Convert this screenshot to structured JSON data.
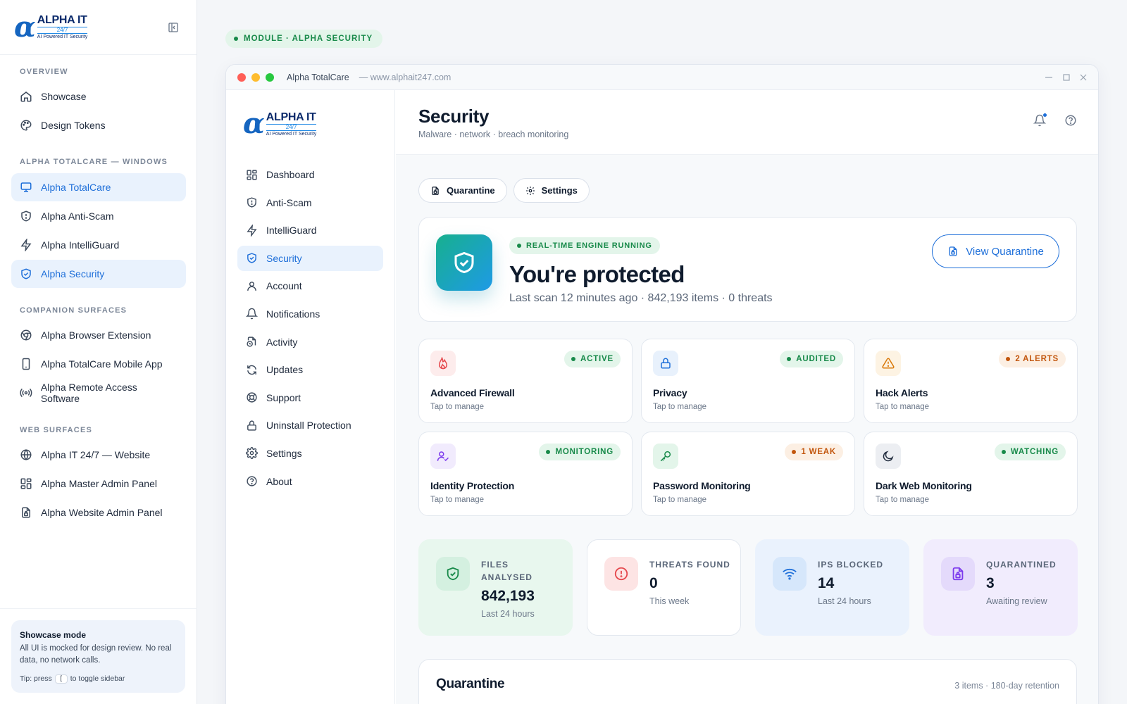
{
  "brand": {
    "name": "ALPHA IT",
    "tagline_247": "24/7",
    "tagline": "AI Powered IT Security"
  },
  "sidebar": {
    "sections": [
      {
        "title": "OVERVIEW",
        "items": [
          {
            "label": "Showcase",
            "icon": "home-icon"
          },
          {
            "label": "Design Tokens",
            "icon": "palette-icon"
          }
        ]
      },
      {
        "title": "ALPHA TOTALCARE — WINDOWS",
        "items": [
          {
            "label": "Alpha TotalCare",
            "icon": "monitor-icon",
            "active": true
          },
          {
            "label": "Alpha Anti-Scam",
            "icon": "shield-alert-icon"
          },
          {
            "label": "Alpha IntelliGuard",
            "icon": "lightning-icon"
          },
          {
            "label": "Alpha Security",
            "icon": "shield-check-icon",
            "active": true
          }
        ]
      },
      {
        "title": "COMPANION SURFACES",
        "items": [
          {
            "label": "Alpha Browser Extension",
            "icon": "chrome-icon"
          },
          {
            "label": "Alpha TotalCare Mobile App",
            "icon": "phone-icon"
          },
          {
            "label": "Alpha Remote Access Software",
            "icon": "broadcast-icon"
          }
        ]
      },
      {
        "title": "WEB SURFACES",
        "items": [
          {
            "label": "Alpha IT 24/7 — Website",
            "icon": "globe-icon"
          },
          {
            "label": "Alpha Master Admin Panel",
            "icon": "grid-icon"
          },
          {
            "label": "Alpha Website Admin Panel",
            "icon": "file-lock-icon"
          }
        ]
      }
    ],
    "showcase": {
      "title": "Showcase mode",
      "desc": "All UI is mocked for design review. No real data, no network calls.",
      "tip_pre": "Tip: press",
      "tip_key": "[",
      "tip_post": "to toggle sidebar"
    }
  },
  "module_pill": "MODULE · ALPHA SECURITY",
  "window": {
    "title": "Alpha TotalCare",
    "url": "— www.alphait247.com",
    "nav": [
      {
        "label": "Dashboard",
        "icon": "grid-icon"
      },
      {
        "label": "Anti-Scam",
        "icon": "shield-alert-icon"
      },
      {
        "label": "IntelliGuard",
        "icon": "lightning-icon"
      },
      {
        "label": "Security",
        "icon": "shield-check-icon",
        "active": true
      },
      {
        "label": "Account",
        "icon": "user-icon"
      },
      {
        "label": "Notifications",
        "icon": "bell-icon"
      },
      {
        "label": "Activity",
        "icon": "file-clock-icon"
      },
      {
        "label": "Updates",
        "icon": "refresh-icon"
      },
      {
        "label": "Support",
        "icon": "lifebuoy-icon"
      },
      {
        "label": "Uninstall Protection",
        "icon": "lock-icon"
      },
      {
        "label": "Settings",
        "icon": "gear-icon"
      },
      {
        "label": "About",
        "icon": "help-icon"
      }
    ],
    "page": {
      "title": "Security",
      "subtitle": "Malware · network · breach monitoring"
    },
    "actions": {
      "quarantine": "Quarantine",
      "settings": "Settings"
    },
    "hero": {
      "pill": "REAL-TIME ENGINE RUNNING",
      "title": "You're protected",
      "subtitle": "Last scan 12 minutes ago · 842,193 items · 0 threats",
      "button": "View Quarantine"
    },
    "features": [
      {
        "name": "Advanced Firewall",
        "sub": "Tap to manage",
        "badge": "ACTIVE",
        "tone": "green",
        "icon": "flame-icon",
        "icon_color": "#e5484d",
        "icon_bg": "#fdecec"
      },
      {
        "name": "Privacy",
        "sub": "Tap to manage",
        "badge": "AUDITED",
        "tone": "green",
        "icon": "lock-icon",
        "icon_color": "#1e6fd9",
        "icon_bg": "#e8f1fc"
      },
      {
        "name": "Hack Alerts",
        "sub": "Tap to manage",
        "badge": "2 ALERTS",
        "tone": "orange",
        "icon": "warning-icon",
        "icon_color": "#d97706",
        "icon_bg": "#fdf3e3"
      },
      {
        "name": "Identity Protection",
        "sub": "Tap to manage",
        "badge": "MONITORING",
        "tone": "green",
        "icon": "user-check-icon",
        "icon_color": "#7c3aed",
        "icon_bg": "#f1ebfd"
      },
      {
        "name": "Password Monitoring",
        "sub": "Tap to manage",
        "badge": "1 WEAK",
        "tone": "orange",
        "icon": "key-icon",
        "icon_color": "#188a4a",
        "icon_bg": "#e3f5ea"
      },
      {
        "name": "Dark Web Monitoring",
        "sub": "Tap to manage",
        "badge": "WATCHING",
        "tone": "green",
        "icon": "moon-icon",
        "icon_color": "#1f2a3c",
        "icon_bg": "#eceef2"
      }
    ],
    "stats": [
      {
        "label": "FILES ANALYSED",
        "value": "842,193",
        "sub": "Last 24 hours",
        "icon": "shield-check-icon",
        "bg": "#e8f7ee",
        "icon_bg": "#d4f0e0",
        "icon_color": "#188a4a"
      },
      {
        "label": "THREATS FOUND",
        "value": "0",
        "sub": "This week",
        "icon": "alert-circle-icon",
        "bg": "#ffffff",
        "icon_bg": "#fde4e4",
        "icon_color": "#e5484d"
      },
      {
        "label": "IPS BLOCKED",
        "value": "14",
        "sub": "Last 24 hours",
        "icon": "wifi-icon",
        "bg": "#eaf2fd",
        "icon_bg": "#d6e7fb",
        "icon_color": "#1e6fd9"
      },
      {
        "label": "QUARANTINED",
        "value": "3",
        "sub": "Awaiting review",
        "icon": "file-lock-icon",
        "bg": "#f1ecfd",
        "icon_bg": "#e4dafb",
        "icon_color": "#7c3aed"
      }
    ],
    "quarantine": {
      "title": "Quarantine",
      "meta": "3 items · 180-day retention"
    }
  }
}
